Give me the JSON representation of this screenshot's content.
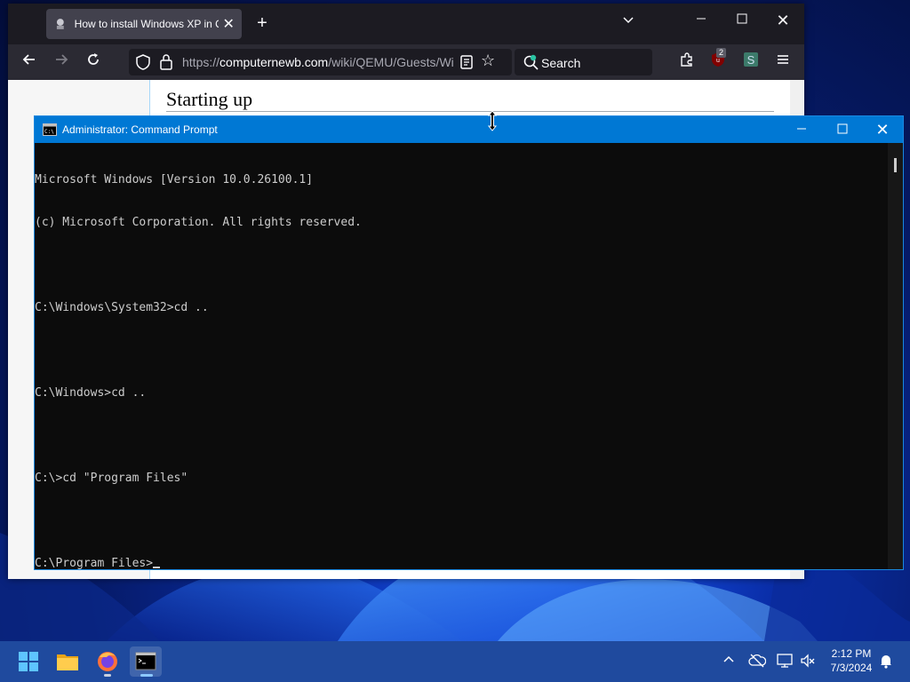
{
  "browser": {
    "tab": {
      "title": "How to install Windows XP in QEMU",
      "favicon": "computernewb-icon"
    },
    "url": {
      "host_prefix": "https://",
      "host": "computernewb.com",
      "path": "/wiki/QEMU/Guests/Windows_XP"
    },
    "search_placeholder": "Search",
    "ublock_badge": "2",
    "page_heading": "Starting up"
  },
  "cmd": {
    "title": "Administrator: Command Prompt",
    "lines": [
      "Microsoft Windows [Version 10.0.26100.1]",
      "(c) Microsoft Corporation. All rights reserved.",
      "",
      "C:\\Windows\\System32>cd ..",
      "",
      "C:\\Windows>cd ..",
      "",
      "C:\\>cd \"Program Files\"",
      "",
      "C:\\Program Files>"
    ]
  },
  "taskbar": {
    "apps": [
      "start-button",
      "file-explorer",
      "firefox",
      "terminal"
    ],
    "clock_time": "2:12 PM",
    "clock_date": "7/3/2024"
  },
  "colors": {
    "cmd_title": "#0078d4",
    "cmd_bg": "#0c0c0c",
    "taskbar": "#1f4a9e",
    "browser_chrome": "#2b2a33"
  }
}
